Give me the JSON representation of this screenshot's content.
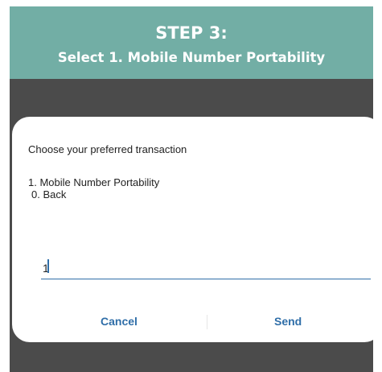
{
  "header": {
    "step": "STEP 3:",
    "instruction": "Select 1. Mobile Number Portability",
    "color": "#72aea5"
  },
  "dialog": {
    "prompt": "Choose your preferred transaction",
    "options": [
      "1. Mobile Number Portability",
      "0. Back"
    ],
    "input_value": "1",
    "cancel_label": "Cancel",
    "send_label": "Send",
    "accent_color": "#2f6ea8",
    "backdrop_color": "#4b4b4b"
  }
}
